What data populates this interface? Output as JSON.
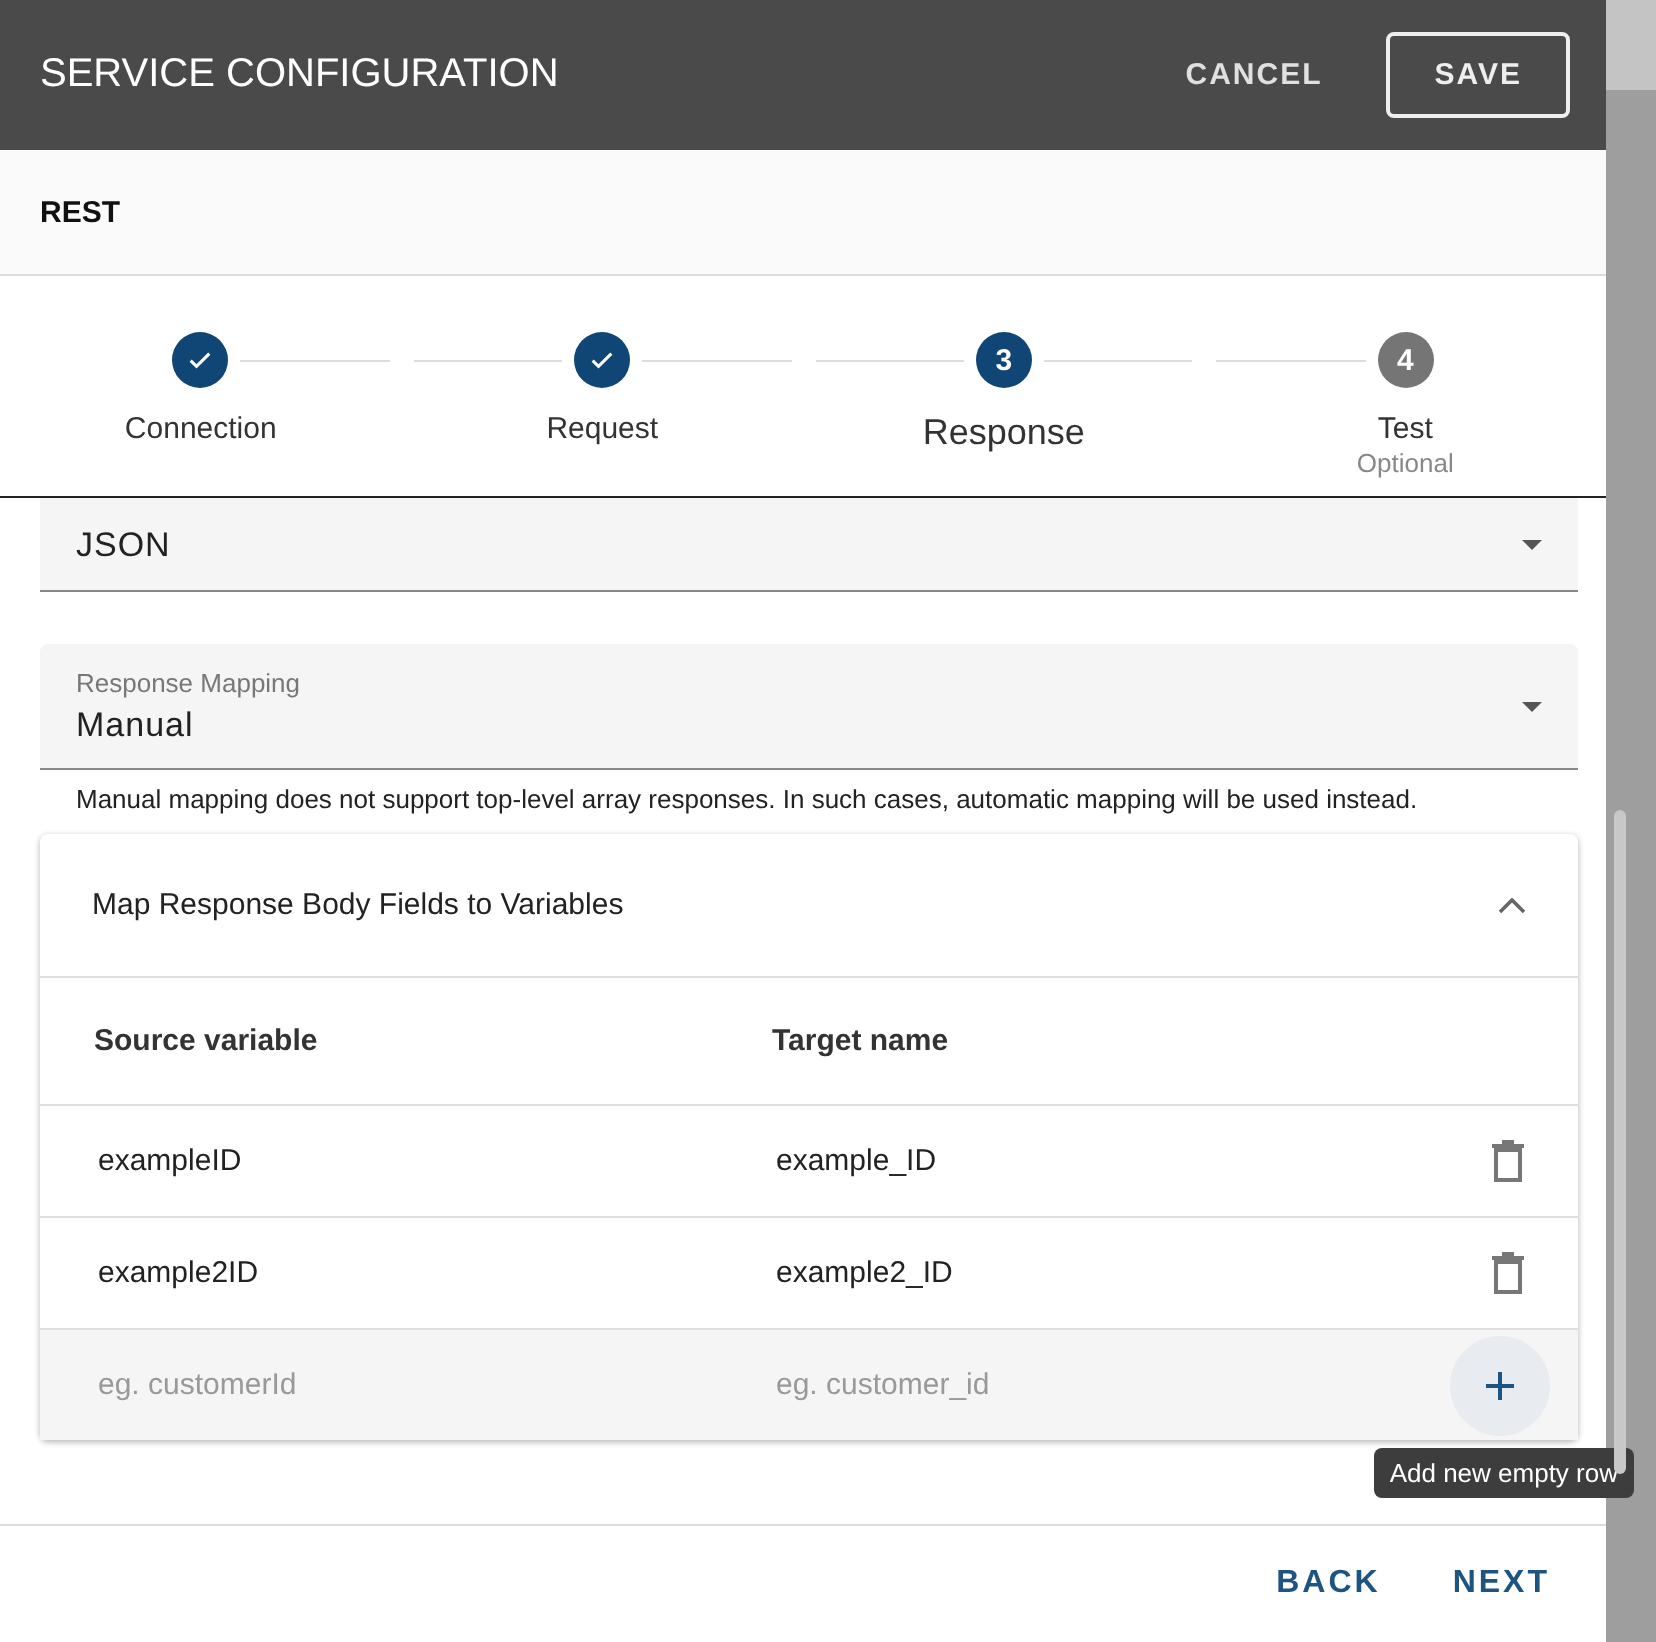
{
  "dialog": {
    "title": "SERVICE CONFIGURATION",
    "actions": [
      {
        "label": "CANCEL",
        "kind": "text"
      },
      {
        "label": "SAVE",
        "kind": "outlined"
      }
    ]
  },
  "service_type": "REST",
  "steps": [
    {
      "label": "Connection",
      "kind": "done"
    },
    {
      "label": "Request",
      "kind": "done"
    },
    {
      "label": "Response",
      "number": "3",
      "kind": "active"
    },
    {
      "label": "Test",
      "number": "4",
      "kind": "pending",
      "note": "Optional"
    }
  ],
  "fields": [
    {
      "value": "JSON"
    },
    {
      "label": "Response Mapping",
      "value": "Manual"
    }
  ],
  "help_text": "Manual mapping does not support top-level array responses. In such cases, automatic mapping will be used instead.",
  "panel": {
    "title": "Map Response Body Fields to Variables",
    "expanded": true,
    "columns": [
      "Source variable",
      "Target name"
    ],
    "rows": [
      {
        "source": "exampleID",
        "target": "example_ID"
      },
      {
        "source": "example2ID",
        "target": "example2_ID"
      }
    ],
    "new_row": {
      "source_placeholder": "eg. customerId",
      "target_placeholder": "eg. customer_id"
    },
    "tooltip": "Add new empty row"
  },
  "footer": [
    "BACK",
    "NEXT"
  ]
}
